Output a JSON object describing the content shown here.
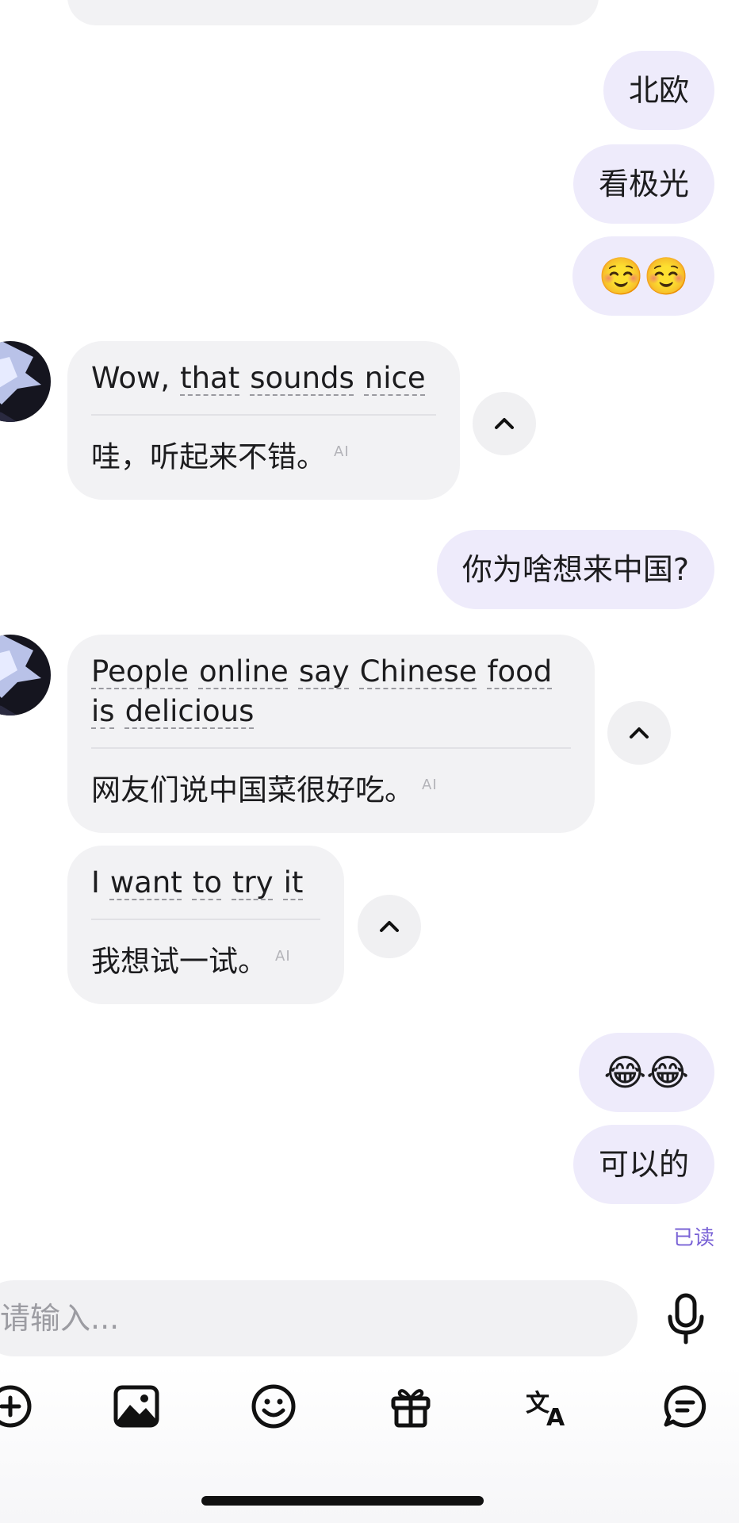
{
  "colors": {
    "outgoing_bubble": "#eeebfb",
    "incoming_bubble": "#f2f2f4",
    "read_receipt": "#7a63d6",
    "background": "#ffffff"
  },
  "messages": {
    "out1": "北欧",
    "out2": "看极光",
    "out3": "☺️☺️",
    "in1": {
      "en_words": [
        "Wow,",
        "that",
        "sounds",
        "nice"
      ],
      "zh": "哇，听起来不错。",
      "ai_tag": "AI"
    },
    "out4": "你为啥想来中国?",
    "in2": {
      "en_words": [
        "People",
        "online",
        "say",
        "Chinese",
        "food",
        "is",
        "delicious"
      ],
      "zh": "网友们说中国菜很好吃。",
      "ai_tag": "AI"
    },
    "in3": {
      "en_words": [
        "I",
        "want",
        "to",
        "try",
        "it"
      ],
      "zh": "我想试一试。",
      "ai_tag": "AI"
    },
    "out5": "😂😂",
    "out6": "可以的"
  },
  "read_receipt": "已读",
  "input": {
    "placeholder": "请输入..."
  },
  "icons": {
    "mic": "microphone-icon",
    "add": "plus-circle-icon",
    "image": "image-icon",
    "emoji": "smiley-icon",
    "gift": "gift-icon",
    "translate": "translate-icon",
    "quick_reply": "chat-bubble-icon",
    "collapse": "chevron-up-icon"
  }
}
